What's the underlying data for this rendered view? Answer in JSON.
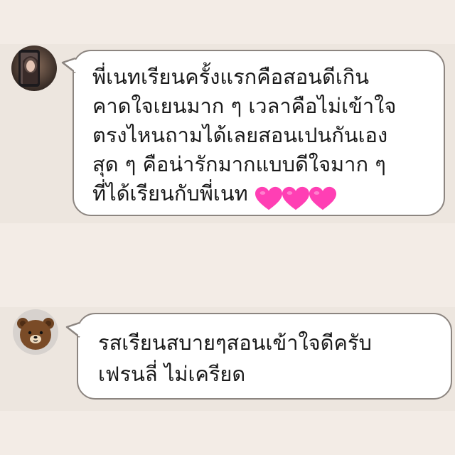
{
  "chat": {
    "messages": [
      {
        "sender_avatar": "user-photo-avatar",
        "text": "พี่เนทเรียนครั้งแรกคือสอนดีเกิน\nคาดใจเยนมาก ๆ เวลาคือไม่เข้าใจ\nตรงไหนถามได้เลยสอนเปนกันเอง\nสุด ๆ คือน่ารักมากแบบดีใจมาก ๆ\nที่ได้เรียนกับพี่เนท",
        "emoji": [
          "pink-heart",
          "pink-heart",
          "pink-heart"
        ]
      },
      {
        "sender_avatar": "brown-bear-avatar",
        "text": "รสเรียนสบายๆสอนเข้าใจดีครับ\nเฟรนลี่ ไม่เครียด"
      }
    ]
  },
  "colors": {
    "background": "#f3ece6",
    "band": "#ede6df",
    "bubble": "#ffffff",
    "bubble_border": "#8c8580",
    "text": "#1a1a1a",
    "heart": "#ff3fb4"
  }
}
